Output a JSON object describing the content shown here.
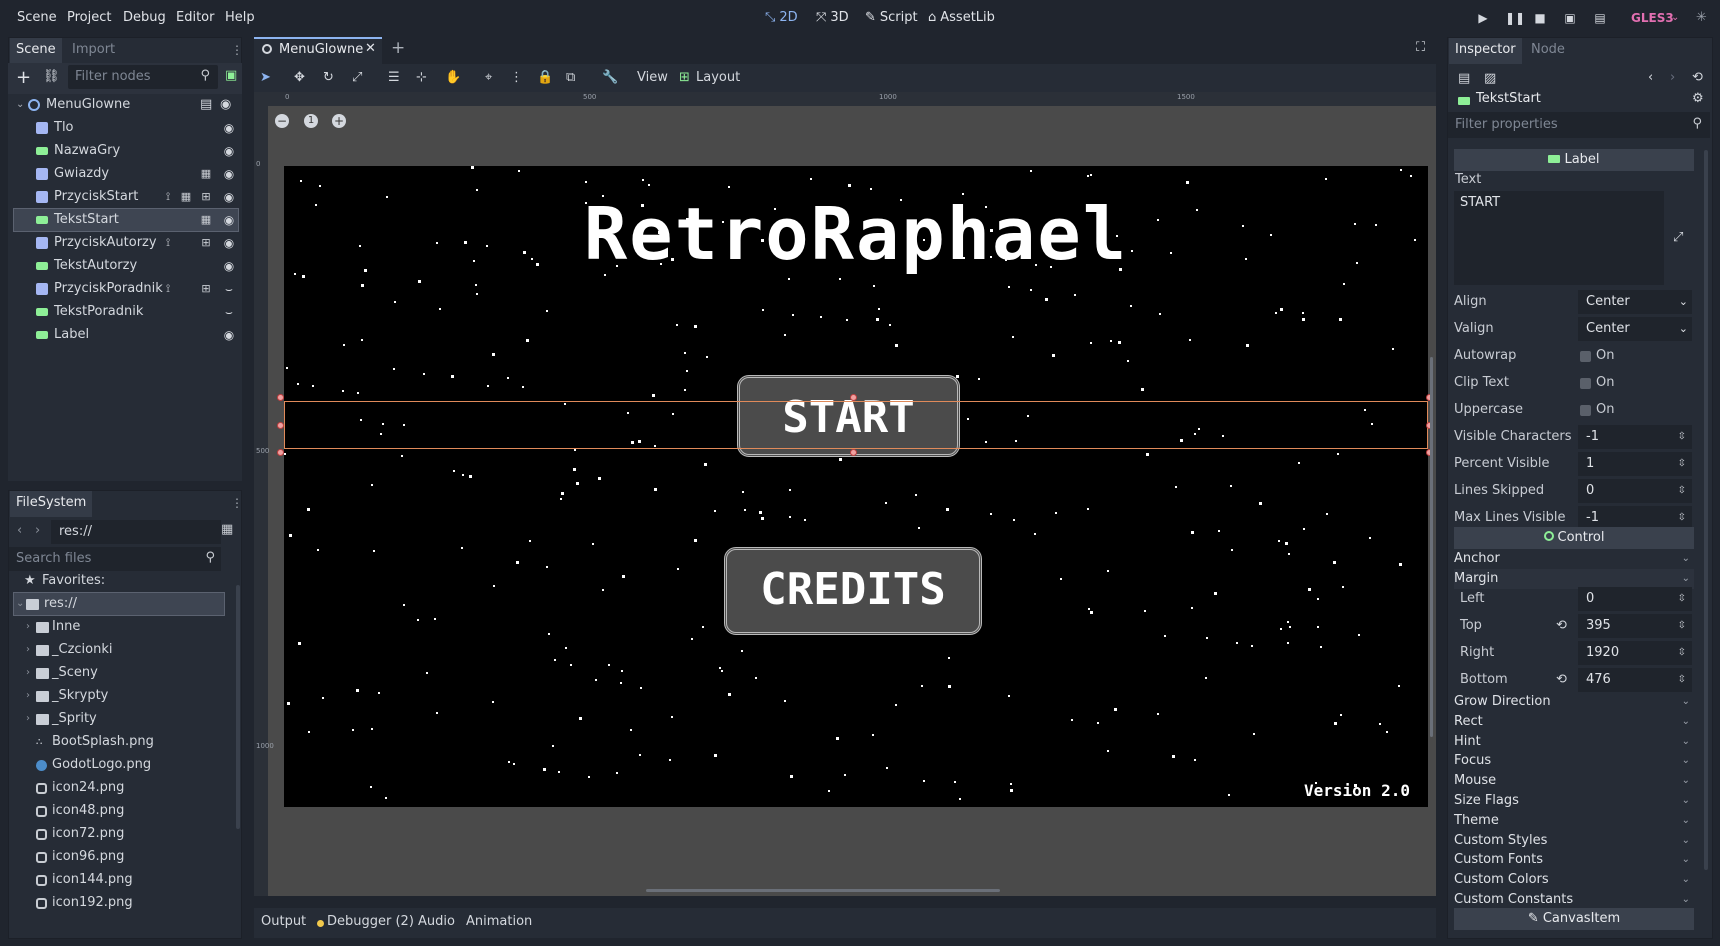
{
  "menu": [
    "Scene",
    "Project",
    "Debug",
    "Editor",
    "Help"
  ],
  "workspaces": {
    "w2d": "2D",
    "w3d": "3D",
    "script": "Script",
    "assetlib": "AssetLib"
  },
  "renderer": "GLES3",
  "colors": {
    "accent": "#8db4f0",
    "selection": "#e08a5a",
    "label_green": "#8eef97",
    "renderer": "#e26fb1"
  },
  "scene_panel": {
    "tabs": [
      "Scene",
      "Import"
    ],
    "filter_placeholder": "Filter nodes",
    "root": "MenuGlowne",
    "nodes": [
      {
        "name": "Tlo",
        "icon": "sprite-icon"
      },
      {
        "name": "NazwaGry",
        "icon": "label-icon"
      },
      {
        "name": "Gwiazdy",
        "icon": "particles-icon"
      },
      {
        "name": "PrzyciskStart",
        "icon": "texture-button-icon"
      },
      {
        "name": "TekstStart",
        "icon": "label-icon"
      },
      {
        "name": "PrzyciskAutorzy",
        "icon": "texture-button-icon"
      },
      {
        "name": "TekstAutorzy",
        "icon": "label-icon"
      },
      {
        "name": "PrzyciskPoradnik",
        "icon": "texture-button-icon"
      },
      {
        "name": "TekstPoradnik",
        "icon": "label-icon"
      },
      {
        "name": "Label",
        "icon": "label-icon"
      }
    ]
  },
  "filesystem": {
    "title": "FileSystem",
    "path": "res://",
    "search_placeholder": "Search files",
    "favorites": "Favorites:",
    "root": "res://",
    "folders": [
      "Inne",
      "_Czcionki",
      "_Sceny",
      "_Skrypty",
      "_Sprity"
    ],
    "files": [
      "BootSplash.png",
      "GodotLogo.png",
      "icon24.png",
      "icon48.png",
      "icon72.png",
      "icon96.png",
      "icon144.png",
      "icon192.png"
    ]
  },
  "editor_tab": "MenuGlowne",
  "toolbar": {
    "view": "View",
    "layout": "Layout"
  },
  "zoom_reset": "1",
  "ruler": [
    "0",
    "500",
    "1000",
    "1500"
  ],
  "ruler_v": [
    "0",
    "500",
    "1000"
  ],
  "canvas": {
    "title": "RetroRaphael",
    "start": "START",
    "credits": "CREDITS",
    "version": "Version 2.0"
  },
  "bottom_tabs": {
    "output": "Output",
    "debugger": "Debugger (2)",
    "audio": "Audio",
    "animation": "Animation"
  },
  "inspector": {
    "tabs": [
      "Inspector",
      "Node"
    ],
    "node": "TekstStart",
    "filter_placeholder": "Filter properties",
    "label_section": "Label",
    "text_label": "Text",
    "text_value": "START",
    "props": [
      {
        "k": "Align",
        "v": "Center",
        "type": "dropdown"
      },
      {
        "k": "Valign",
        "v": "Center",
        "type": "dropdown"
      },
      {
        "k": "Autowrap",
        "v": "On",
        "type": "check"
      },
      {
        "k": "Clip Text",
        "v": "On",
        "type": "check"
      },
      {
        "k": "Uppercase",
        "v": "On",
        "type": "check"
      },
      {
        "k": "Visible Characters",
        "v": "-1",
        "type": "spin"
      },
      {
        "k": "Percent Visible",
        "v": "1",
        "type": "spin"
      },
      {
        "k": "Lines Skipped",
        "v": "0",
        "type": "spin"
      },
      {
        "k": "Max Lines Visible",
        "v": "-1",
        "type": "spin"
      }
    ],
    "control_section": "Control",
    "anchor": "Anchor",
    "margin": "Margin",
    "margins": [
      {
        "k": "Left",
        "v": "0"
      },
      {
        "k": "Top",
        "v": "395"
      },
      {
        "k": "Right",
        "v": "1920"
      },
      {
        "k": "Bottom",
        "v": "476"
      }
    ],
    "groups": [
      "Grow Direction",
      "Rect",
      "Hint",
      "Focus",
      "Mouse",
      "Size Flags",
      "Theme",
      "Custom Styles",
      "Custom Fonts",
      "Custom Colors",
      "Custom Constants"
    ],
    "canvasitem_section": "CanvasItem"
  }
}
